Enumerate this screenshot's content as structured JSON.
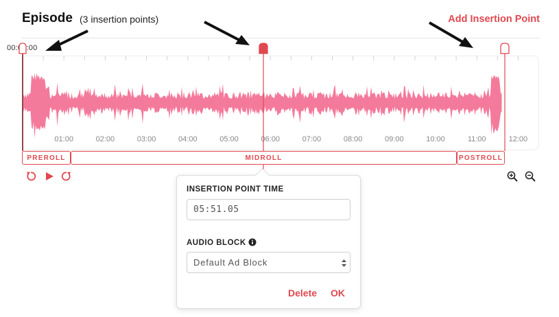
{
  "header": {
    "title": "Episode",
    "subtitle": "(3 insertion points)",
    "add_button": "Add Insertion Point"
  },
  "playhead_time": "00:00:00",
  "timeline": {
    "tick_labels": [
      "01:00",
      "02:00",
      "03:00",
      "04:00",
      "05:00",
      "06:00",
      "07:00",
      "08:00",
      "09:00",
      "10:00",
      "11:00",
      "12:00"
    ],
    "colors": {
      "accent": "#e0484f",
      "wave": "#f47a9b"
    }
  },
  "regions": [
    {
      "label": "PREROLL"
    },
    {
      "label": "MIDROLL"
    },
    {
      "label": "POSTROLL"
    }
  ],
  "controls": {
    "icons": [
      "rewind-icon",
      "play-icon",
      "forward-icon",
      "zoom-in-icon",
      "zoom-out-icon"
    ]
  },
  "popover": {
    "time_label": "INSERTION POINT TIME",
    "time_value": "05:51.05",
    "block_label": "AUDIO BLOCK",
    "block_value": "Default Ad Block",
    "delete_label": "Delete",
    "ok_label": "OK"
  }
}
